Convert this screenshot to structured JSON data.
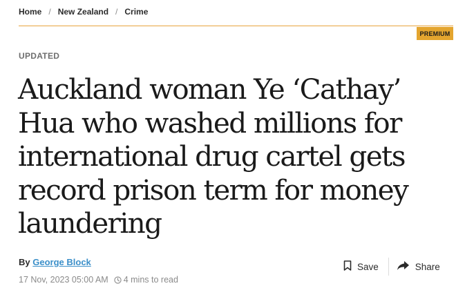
{
  "breadcrumb": {
    "items": [
      "Home",
      "New Zealand",
      "Crime"
    ],
    "separator": "/"
  },
  "badge": {
    "label": "PREMIUM",
    "color": "#e4a52f"
  },
  "status_label": "UPDATED",
  "article": {
    "headline": "Auckland woman Ye ‘Cathay’ Hua who washed millions for international drug cartel gets record prison term for money laundering",
    "byline_prefix": "By",
    "author": "George Block",
    "date": "17 Nov, 2023 05:00 AM",
    "read_time": "4 mins to read"
  },
  "actions": {
    "save_label": "Save",
    "save_icon": "bookmark-icon",
    "share_label": "Share",
    "share_icon": "share-arrow-icon"
  },
  "colors": {
    "accent": "#e8a33d",
    "link": "#3b8fc9"
  }
}
